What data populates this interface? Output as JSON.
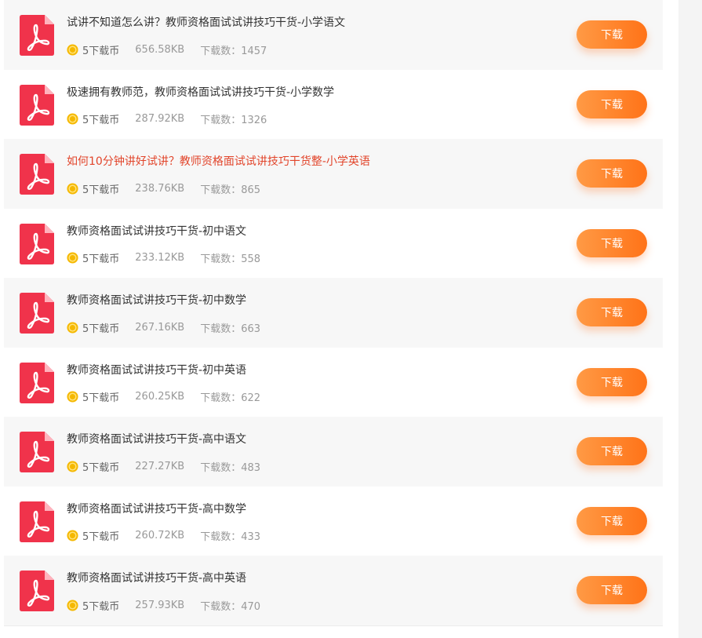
{
  "colors": {
    "accent_button": "#ff7f24",
    "highlight_title": "#e2452b",
    "pdf_icon": "#f0334b",
    "coin": "#f5b800"
  },
  "download_list": [
    {
      "title": "试讲不知道怎么讲？教师资格面试试讲技巧干货-小学语文",
      "cost": "5下载币",
      "size": "656.58KB",
      "downloads": "下载数：1457",
      "button": "下载",
      "icon": "pdf-icon"
    },
    {
      "title": "极速拥有教师范，教师资格面试试讲技巧干货-小学数学",
      "cost": "5下载币",
      "size": "287.92KB",
      "downloads": "下载数：1326",
      "button": "下载",
      "icon": "pdf-icon"
    },
    {
      "title": "如何10分钟讲好试讲？教师资格面试试讲技巧干货整-小学英语",
      "cost": "5下载币",
      "size": "238.76KB",
      "downloads": "下载数：865",
      "button": "下载",
      "icon": "pdf-icon"
    },
    {
      "title": "教师资格面试试讲技巧干货-初中语文",
      "cost": "5下载币",
      "size": "233.12KB",
      "downloads": "下载数：558",
      "button": "下载",
      "icon": "pdf-icon"
    },
    {
      "title": "教师资格面试试讲技巧干货-初中数学",
      "cost": "5下载币",
      "size": "267.16KB",
      "downloads": "下载数：663",
      "button": "下载",
      "icon": "pdf-icon"
    },
    {
      "title": "教师资格面试试讲技巧干货-初中英语",
      "cost": "5下载币",
      "size": "260.25KB",
      "downloads": "下载数：622",
      "button": "下载",
      "icon": "pdf-icon"
    },
    {
      "title": "教师资格面试试讲技巧干货-高中语文",
      "cost": "5下载币",
      "size": "227.27KB",
      "downloads": "下载数：483",
      "button": "下载",
      "icon": "pdf-icon"
    },
    {
      "title": "教师资格面试试讲技巧干货-高中数学",
      "cost": "5下载币",
      "size": "260.72KB",
      "downloads": "下载数：433",
      "button": "下载",
      "icon": "pdf-icon"
    },
    {
      "title": "教师资格面试试讲技巧干货-高中英语",
      "cost": "5下载币",
      "size": "257.93KB",
      "downloads": "下载数：470",
      "button": "下载",
      "icon": "pdf-icon"
    }
  ]
}
